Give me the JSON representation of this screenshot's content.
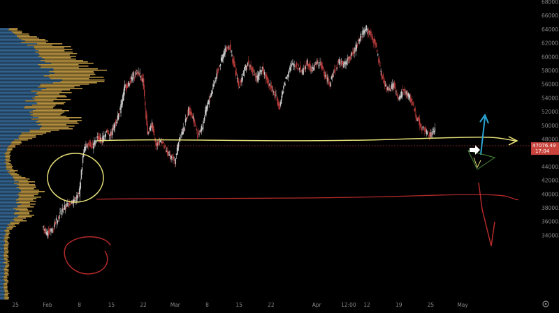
{
  "chart_data": {
    "type": "line",
    "title": "",
    "xlabel": "",
    "ylabel": "",
    "ylim": [
      34000,
      68000
    ],
    "y_ticks": [
      34000,
      36000,
      38000,
      40000,
      42000,
      44000,
      46000,
      48000,
      50000,
      52000,
      54000,
      56000,
      58000,
      60000,
      62000,
      64000,
      66000,
      68000
    ],
    "y_tick_labels": [
      "34000.00",
      "36000.00",
      "38000.00",
      "40000.00",
      "42000.00",
      "44000.00",
      "46000.00",
      "48000.00",
      "50000.00",
      "52000.00",
      "54000.00",
      "56000.00",
      "58000.00",
      "60000.00",
      "62000.00",
      "64000.00",
      "66000.00",
      "68000.00"
    ],
    "x_tick_labels": [
      "25",
      "Feb",
      "8",
      "15",
      "22",
      "Mar",
      "8",
      "15",
      "22",
      "Apr",
      "12:00",
      "12",
      "19",
      "25",
      "May"
    ],
    "x_range_days": [
      -7.2,
      96.5
    ],
    "x_tick_days": [
      -7,
      0,
      7,
      14,
      21,
      28,
      35,
      42,
      49,
      59,
      66,
      70,
      77,
      84,
      91
    ],
    "series": [
      {
        "values": [
          [
            -1,
            35200
          ],
          [
            0,
            34400
          ],
          [
            1,
            34800
          ],
          [
            2,
            36200
          ],
          [
            3,
            37400
          ],
          [
            4,
            38200
          ],
          [
            5,
            38800
          ],
          [
            6,
            39200
          ],
          [
            7,
            40000
          ],
          [
            8,
            46400
          ],
          [
            9,
            47600
          ],
          [
            10,
            47000
          ],
          [
            11,
            48300
          ],
          [
            12,
            47800
          ],
          [
            13,
            49200
          ],
          [
            14,
            48700
          ],
          [
            15,
            50600
          ],
          [
            16,
            52200
          ],
          [
            17,
            55600
          ],
          [
            18,
            56200
          ],
          [
            19,
            57400
          ],
          [
            20,
            57800
          ],
          [
            21,
            56600
          ],
          [
            22,
            48600
          ],
          [
            23,
            50200
          ],
          [
            24,
            47000
          ],
          [
            25,
            48000
          ],
          [
            26,
            46200
          ],
          [
            27,
            45600
          ],
          [
            28,
            44800
          ],
          [
            29,
            48400
          ],
          [
            30,
            49600
          ],
          [
            31,
            52400
          ],
          [
            32,
            51200
          ],
          [
            33,
            48600
          ],
          [
            34,
            49800
          ],
          [
            35,
            52800
          ],
          [
            36,
            54800
          ],
          [
            37,
            57200
          ],
          [
            38,
            59200
          ],
          [
            39,
            61000
          ],
          [
            40,
            61600
          ],
          [
            41,
            58600
          ],
          [
            42,
            55800
          ],
          [
            43,
            57600
          ],
          [
            44,
            59200
          ],
          [
            45,
            58000
          ],
          [
            46,
            56800
          ],
          [
            47,
            58400
          ],
          [
            48,
            57000
          ],
          [
            49,
            55600
          ],
          [
            50,
            54400
          ],
          [
            51,
            52800
          ],
          [
            52,
            56200
          ],
          [
            53,
            58200
          ],
          [
            54,
            59000
          ],
          [
            55,
            58600
          ],
          [
            56,
            57800
          ],
          [
            57,
            59400
          ],
          [
            58,
            58000
          ],
          [
            59,
            59200
          ],
          [
            60,
            58800
          ],
          [
            61,
            57200
          ],
          [
            62,
            56000
          ],
          [
            63,
            58200
          ],
          [
            64,
            59400
          ],
          [
            65,
            58800
          ],
          [
            66,
            59800
          ],
          [
            67,
            60400
          ],
          [
            68,
            62000
          ],
          [
            69,
            63400
          ],
          [
            70,
            64200
          ],
          [
            71,
            63000
          ],
          [
            72,
            61800
          ],
          [
            73,
            58200
          ],
          [
            74,
            55800
          ],
          [
            75,
            55200
          ],
          [
            76,
            56000
          ],
          [
            77,
            53600
          ],
          [
            78,
            55200
          ],
          [
            79,
            54600
          ],
          [
            80,
            53400
          ],
          [
            81,
            51200
          ],
          [
            82,
            49800
          ],
          [
            83,
            49200
          ],
          [
            84,
            48600
          ],
          [
            85,
            49400
          ]
        ]
      }
    ],
    "last_price": "47076.49",
    "countdown": "17:04",
    "lines": {
      "support_yellow": 47800,
      "support_red": 39500
    },
    "colors": {
      "background": "#000000",
      "candles_up": "#c9c9c9",
      "candles_down": "#b83a3a",
      "volume_profile_up": "#3a6fa0",
      "volume_profile_down": "#d4a94a",
      "yellow_annotation": "#e8e27a",
      "red_annotation": "#b52a2a",
      "blue_arrow": "#2aa8d8",
      "price_label": "#c8443c",
      "axis_text": "#8a8a8a"
    }
  },
  "watermark_icon": "tradingview-settings-icon"
}
